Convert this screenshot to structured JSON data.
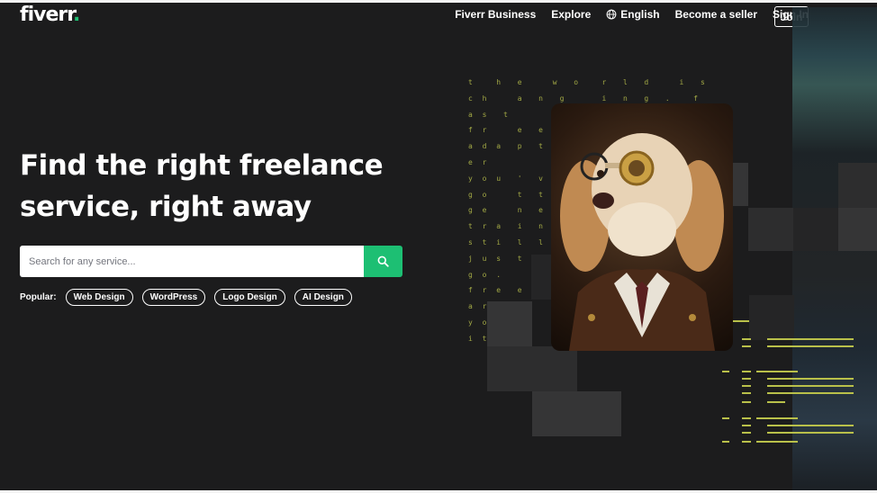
{
  "brand": {
    "logo_text": "fiverr",
    "logo_dot": ".",
    "accent_color": "#1dbf73"
  },
  "nav": {
    "items": [
      "Fiverr Business",
      "Explore",
      "English",
      "Become a seller",
      "Sign In"
    ],
    "join_label": "Join",
    "language_icon": "globe-icon"
  },
  "hero": {
    "title_line1": "Find the right freelance",
    "title_line2": "service, right away"
  },
  "search": {
    "placeholder": "Search for any service...",
    "button_icon": "search-icon"
  },
  "popular": {
    "label": "Popular:",
    "tags": [
      "Web Design",
      "WordPress",
      "Logo Design",
      "AI Design"
    ]
  },
  "artwork": {
    "matrix_lines": [
      "t   h  e    w  o   r  l  d    i  s",
      "c h    a  n  g     i  n  g  .   f",
      "a s  t",
      "f r    e  e",
      "a d a  p  t",
      "e r",
      "y o u  '  v  e",
      "g o    t  t",
      "g e    n  e  e",
      "t r a  i  n",
      "s t i  l  l",
      "j u s  t",
      "g o .",
      "f r e  e",
      "a r e",
      "y o",
      "i t 1 ."
    ],
    "accent_color": "#b9c04a"
  }
}
